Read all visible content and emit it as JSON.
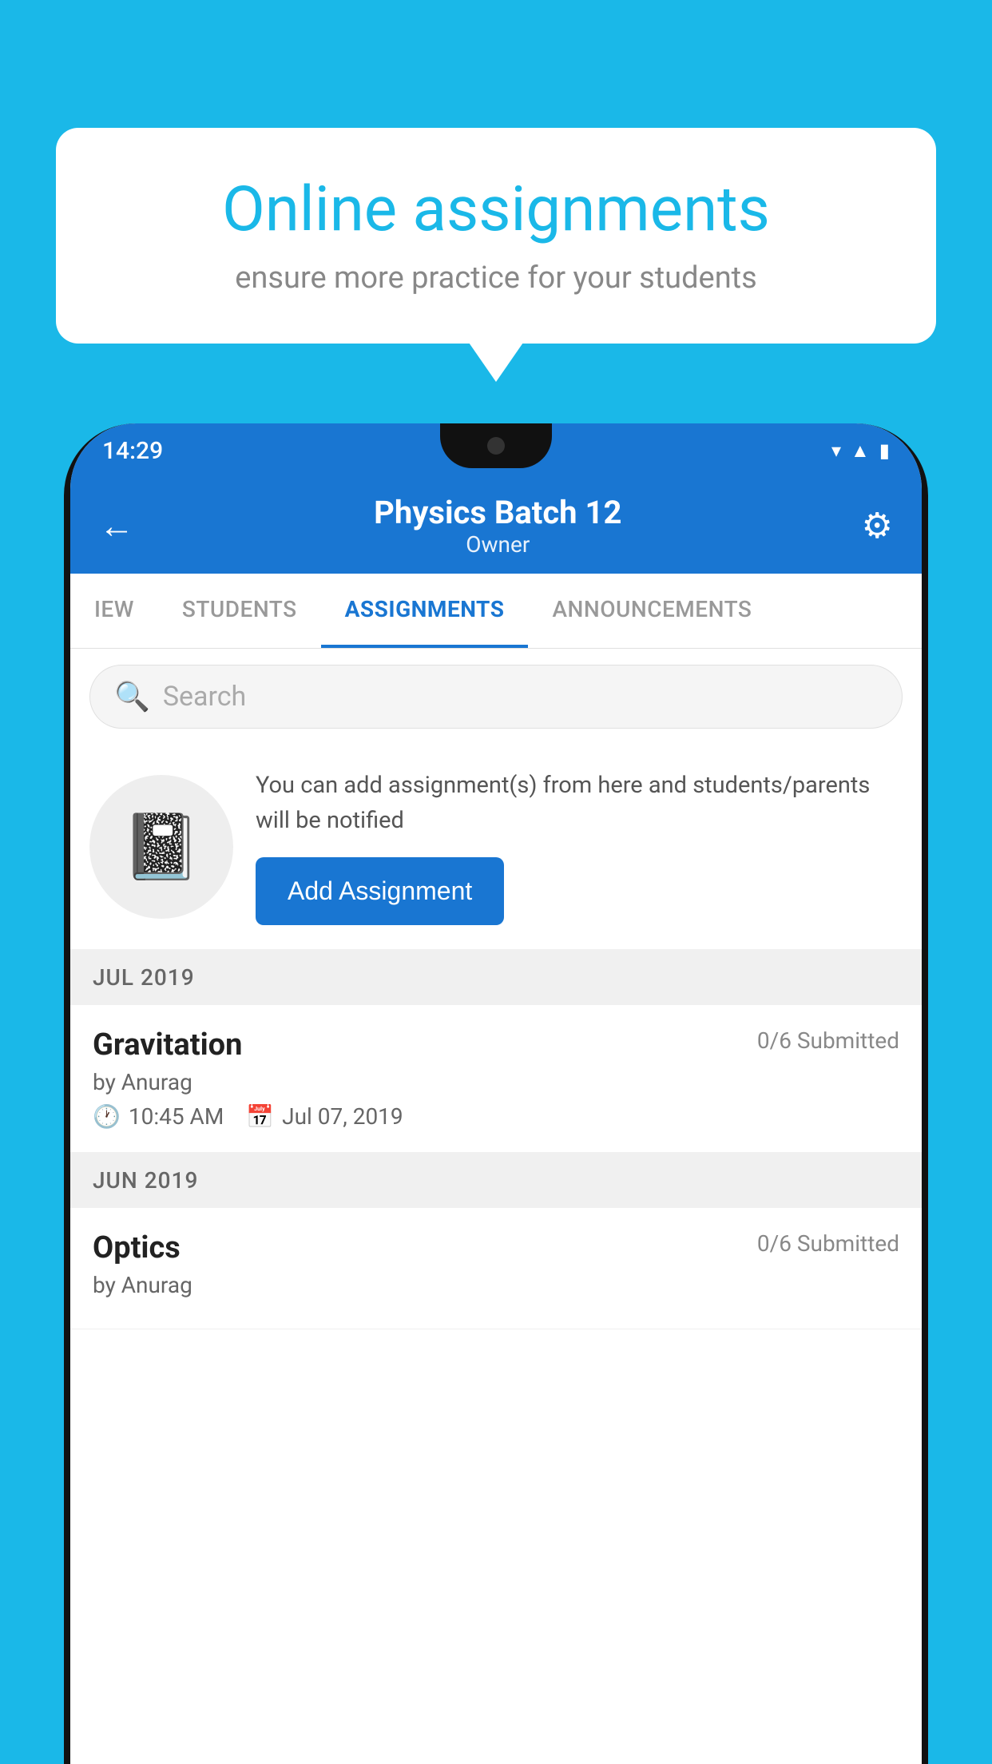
{
  "background_color": "#1ab8e8",
  "speech_bubble": {
    "title": "Online assignments",
    "subtitle": "ensure more practice for your students"
  },
  "status_bar": {
    "time": "14:29",
    "icons": [
      "wifi",
      "signal",
      "battery"
    ]
  },
  "app_header": {
    "title": "Physics Batch 12",
    "subtitle": "Owner",
    "back_label": "←",
    "settings_label": "⚙"
  },
  "tabs": [
    {
      "label": "IEW",
      "active": false
    },
    {
      "label": "STUDENTS",
      "active": false
    },
    {
      "label": "ASSIGNMENTS",
      "active": true
    },
    {
      "label": "ANNOUNCEMENTS",
      "active": false
    }
  ],
  "search": {
    "placeholder": "Search"
  },
  "promo": {
    "description": "You can add assignment(s) from here and students/parents will be notified",
    "add_button_label": "Add Assignment"
  },
  "sections": [
    {
      "label": "JUL 2019",
      "assignments": [
        {
          "title": "Gravitation",
          "submitted": "0/6 Submitted",
          "by": "by Anurag",
          "time": "10:45 AM",
          "date": "Jul 07, 2019"
        }
      ]
    },
    {
      "label": "JUN 2019",
      "assignments": [
        {
          "title": "Optics",
          "submitted": "0/6 Submitted",
          "by": "by Anurag",
          "time": "",
          "date": ""
        }
      ]
    }
  ]
}
